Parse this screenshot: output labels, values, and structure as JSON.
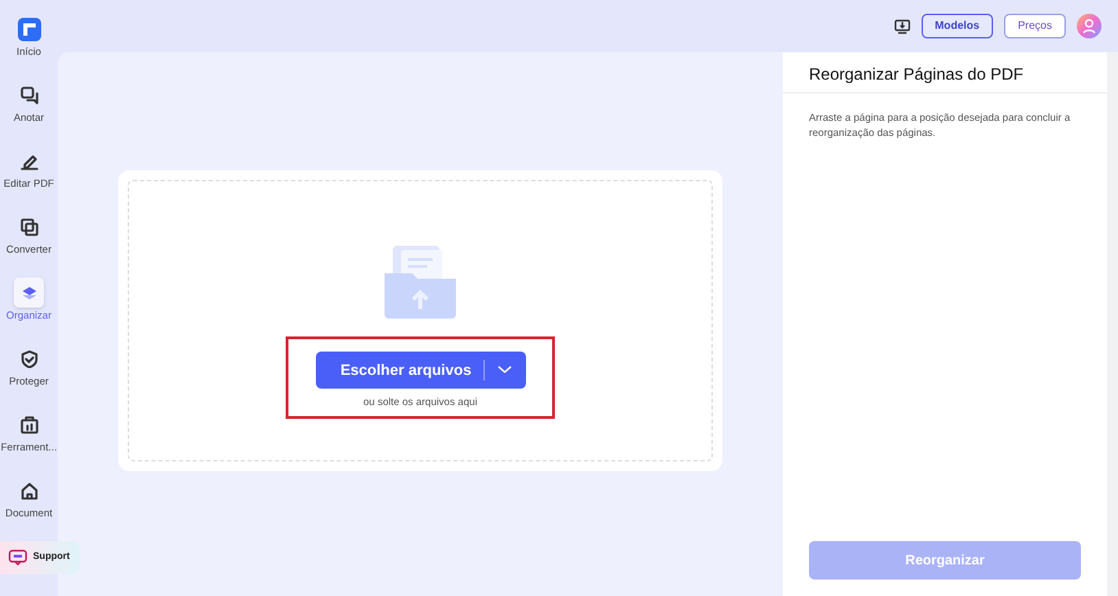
{
  "sidebar": {
    "items": [
      {
        "label": "Início",
        "selected": false
      },
      {
        "label": "Anotar",
        "selected": false
      },
      {
        "label": "Editar PDF",
        "selected": false
      },
      {
        "label": "Converter",
        "selected": false
      },
      {
        "label": "Organizar",
        "selected": true
      },
      {
        "label": "Proteger",
        "selected": false
      },
      {
        "label": "Ferrament...",
        "selected": false
      },
      {
        "label": "Document",
        "selected": false
      }
    ],
    "support": "Support"
  },
  "header": {
    "buttons": [
      {
        "label": "Modelos",
        "selected": true
      },
      {
        "label": "Preços",
        "selected": false
      }
    ]
  },
  "upload": {
    "button": "Escolher arquivos",
    "hint": "ou solte os arquivos aqui",
    "highlighted": true
  },
  "panel": {
    "title": "Reorganizar Páginas do PDF",
    "description": "Arraste a página para a posição desejada para concluir a reorganização das páginas.",
    "button": {
      "label": "Reorganizar",
      "disabled": true
    }
  }
}
